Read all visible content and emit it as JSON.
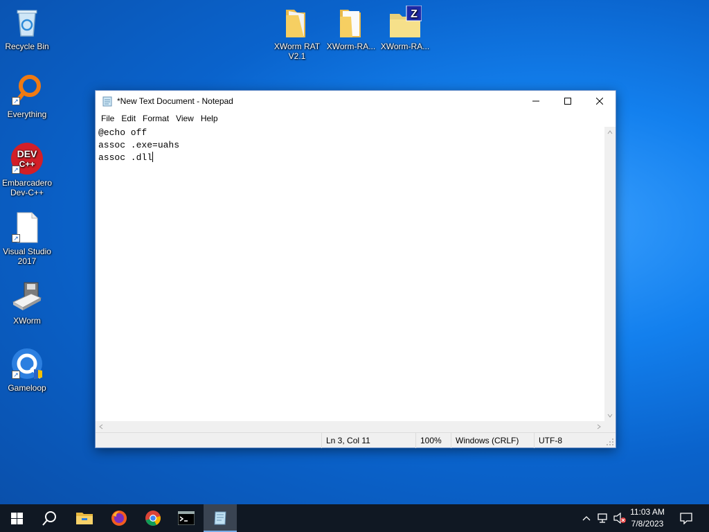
{
  "desktop": {
    "icons": [
      {
        "label": "Recycle Bin"
      },
      {
        "label": "Everything"
      },
      {
        "label": "Embarcadero Dev-C++"
      },
      {
        "label": "Visual Studio 2017"
      },
      {
        "label": "XWorm"
      },
      {
        "label": "Gameloop"
      },
      {
        "label": "XWorm RAT V2.1"
      },
      {
        "label": "XWorm-RA..."
      },
      {
        "label": "XWorm-RA..."
      }
    ]
  },
  "notepad": {
    "title": "*New Text Document - Notepad",
    "menu": [
      "File",
      "Edit",
      "Format",
      "View",
      "Help"
    ],
    "lines": [
      "@echo off",
      "assoc .exe=uahs",
      "assoc .dll"
    ],
    "status": {
      "position": "Ln 3, Col 11",
      "zoom": "100%",
      "line_ending": "Windows (CRLF)",
      "encoding": "UTF-8"
    }
  },
  "taskbar": {
    "apps": [
      "start-icon",
      "search-icon",
      "file-explorer-icon",
      "firefox-icon",
      "chrome-icon",
      "cmd-icon",
      "notepad-icon"
    ],
    "clock": {
      "time": "11:03 AM",
      "date": "7/8/2023"
    }
  }
}
